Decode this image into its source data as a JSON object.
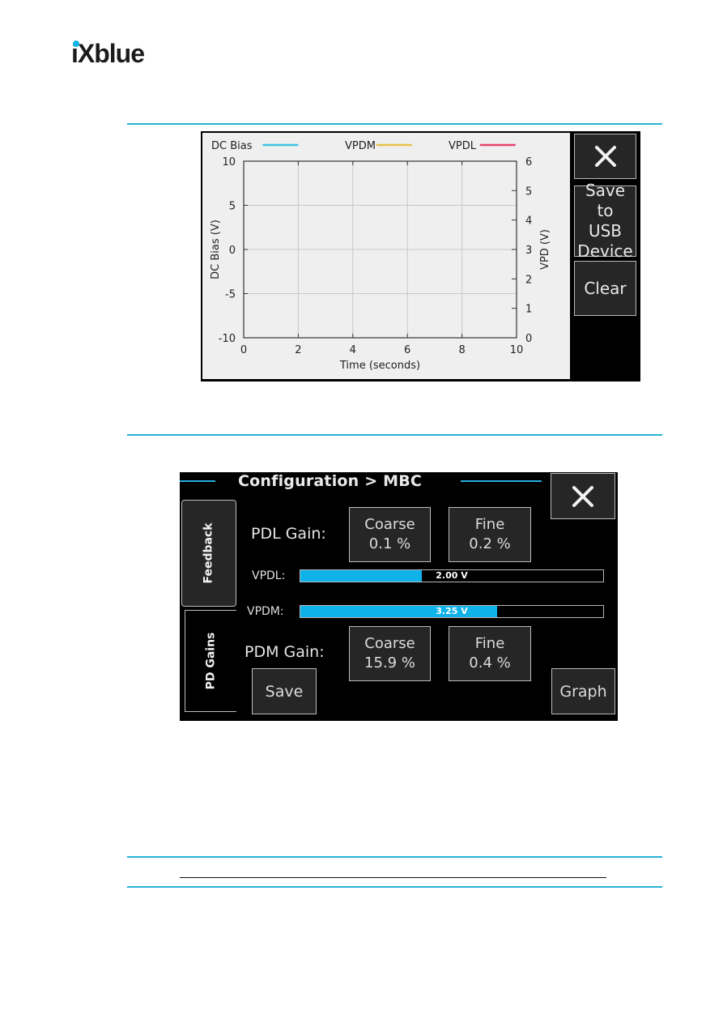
{
  "brand": {
    "logo_text": "iXblue",
    "accent_color": "#12b5e5"
  },
  "graph_screen": {
    "close_icon": "close-icon",
    "buttons": {
      "save_usb_line1": "Save to",
      "save_usb_line2": "USB",
      "save_usb_line3": "Device",
      "clear": "Clear"
    }
  },
  "chart_data": {
    "type": "line",
    "title": "",
    "legend": [
      {
        "name": "DC Bias",
        "color": "#3ec3e6"
      },
      {
        "name": "VPDM",
        "color": "#e8c04a"
      },
      {
        "name": "VPDL",
        "color": "#e6436d"
      }
    ],
    "legend_position": "top",
    "series": [
      {
        "name": "DC Bias",
        "axis": "left",
        "values": []
      },
      {
        "name": "VPDM",
        "axis": "right",
        "values": []
      },
      {
        "name": "VPDL",
        "axis": "right",
        "values": []
      }
    ],
    "xlabel": "Time (seconds)",
    "ylabel": "DC Bias (V)",
    "y2label": "VPD (V)",
    "xlim": [
      0,
      10
    ],
    "ylim": [
      -10,
      10
    ],
    "y2lim": [
      0,
      6
    ],
    "xticks": [
      "0",
      "2",
      "4",
      "6",
      "8",
      "10"
    ],
    "yticks": [
      "10",
      "5",
      "0",
      "-5",
      "-10"
    ],
    "y2ticks": [
      "6",
      "5",
      "4",
      "3",
      "2",
      "1",
      "0"
    ],
    "grid": true
  },
  "config_screen": {
    "title": "Configuration  >  MBC",
    "tabs": [
      {
        "label": "Feedback"
      },
      {
        "label": "PD Gains"
      }
    ],
    "pdl_gain": {
      "label": "PDL Gain:",
      "coarse_label": "Coarse",
      "coarse_value": "0.1 %",
      "fine_label": "Fine",
      "fine_value": "0.2 %"
    },
    "vpdl": {
      "label": "VPDL:",
      "value_text": "2.00 V",
      "fill_fraction": 0.4
    },
    "vpdm": {
      "label": "VPDM:",
      "value_text": "3.25 V",
      "fill_fraction": 0.65
    },
    "pdm_gain": {
      "label": "PDM Gain:",
      "coarse_label": "Coarse",
      "coarse_value": "15.9 %",
      "fine_label": "Fine",
      "fine_value": "0.4 %"
    },
    "buttons": {
      "save": "Save",
      "graph": "Graph"
    }
  }
}
